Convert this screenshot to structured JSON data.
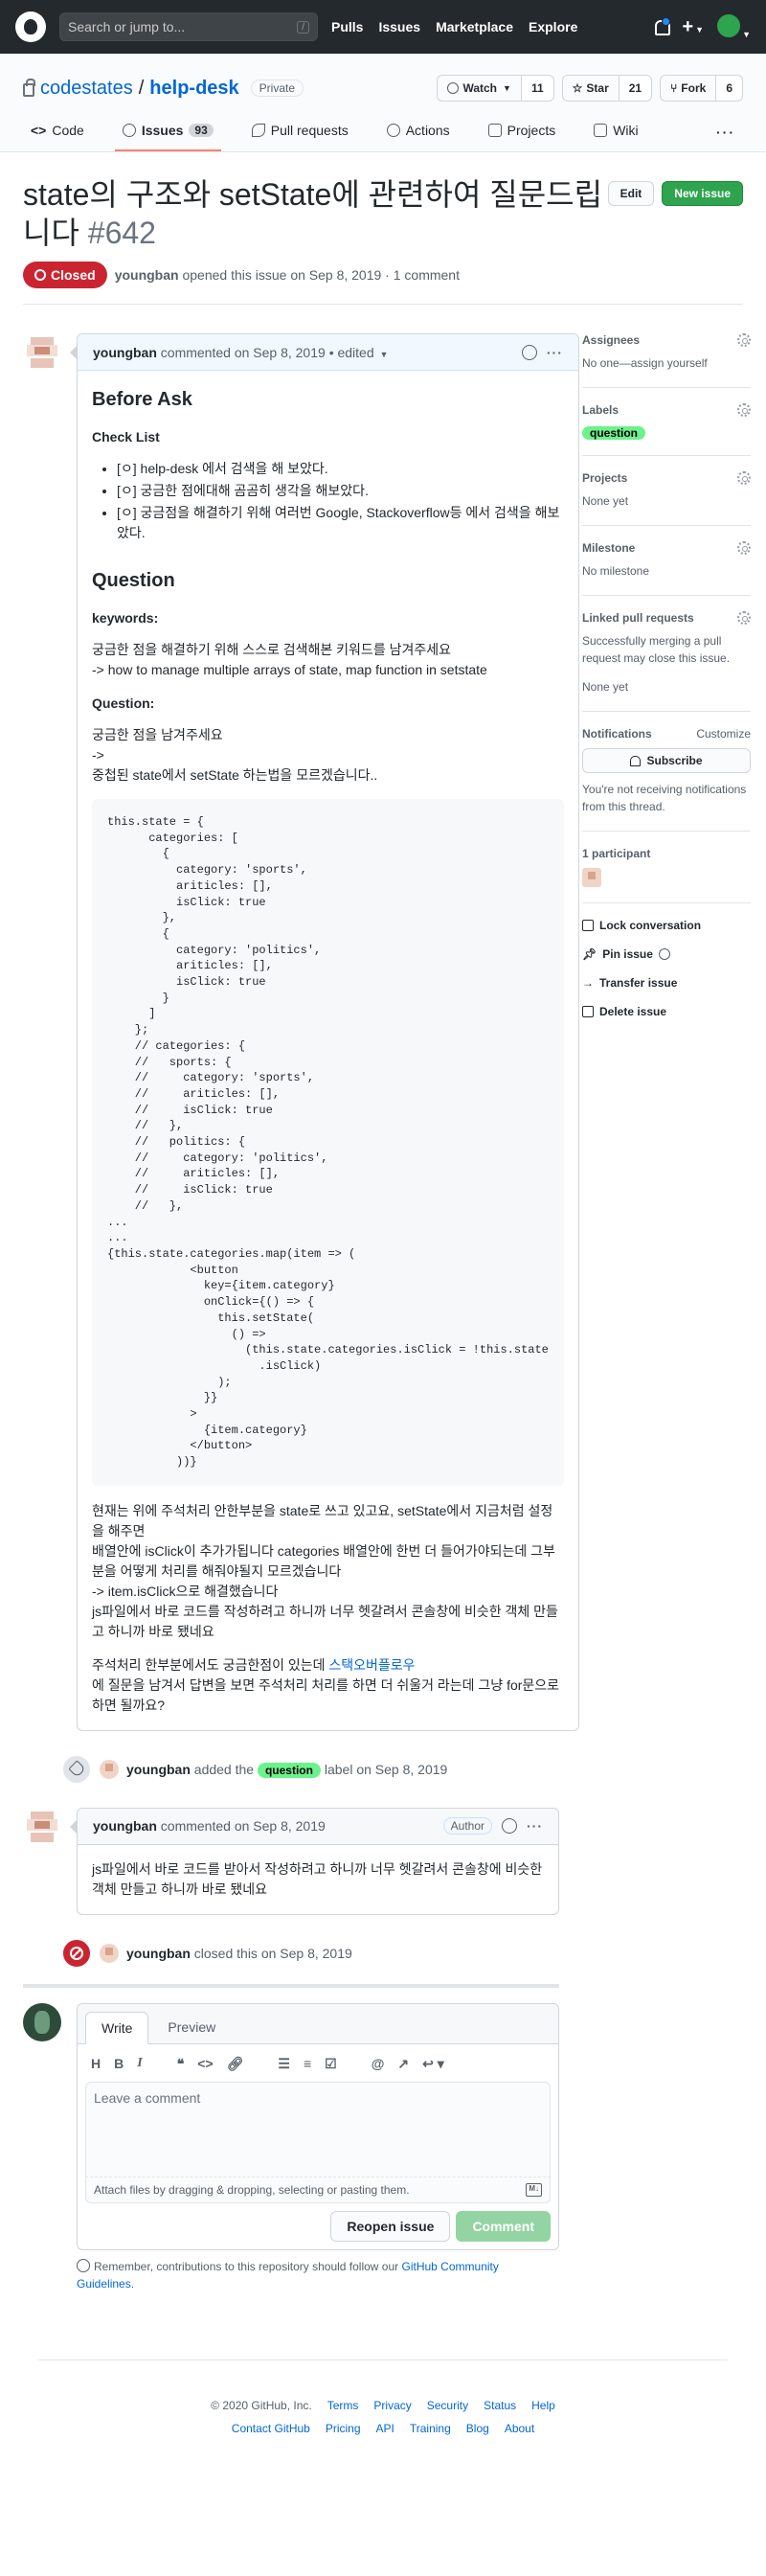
{
  "header": {
    "search_placeholder": "Search or jump to...",
    "slash": "/",
    "nav": [
      "Pulls",
      "Issues",
      "Marketplace",
      "Explore"
    ],
    "plus": "+"
  },
  "repo": {
    "owner": "codestates",
    "separator": "/",
    "name": "help-desk",
    "visibility": "Private",
    "watch_label": "Watch",
    "watch_count": "11",
    "star_label": "Star",
    "star_count": "21",
    "fork_label": "Fork",
    "fork_count": "6",
    "tabs": [
      {
        "label": "Code"
      },
      {
        "label": "Issues",
        "count": "93"
      },
      {
        "label": "Pull requests"
      },
      {
        "label": "Actions"
      },
      {
        "label": "Projects"
      },
      {
        "label": "Wiki"
      }
    ],
    "more": "···"
  },
  "issue": {
    "title": "state의 구조와 setState에 관련하여 질문드립니다",
    "number": "#642",
    "edit_label": "Edit",
    "new_issue_label": "New issue",
    "state": "Closed",
    "author": "youngban",
    "meta": "opened this issue on Sep 8, 2019 · 1 comment"
  },
  "first_comment": {
    "author": "youngban",
    "action": "commented on Sep 8, 2019",
    "edited": "• edited",
    "before_ask": "Before Ask",
    "check_list": "Check List",
    "checklist_items": [
      "[ㅇ] help-desk 에서 검색을 해 보았다.",
      "[ㅇ] 궁금한 점에대해 곰곰히 생각을 해보았다.",
      "[ㅇ] 궁금점을 해결하기 위해 여러번 Google, Stackoverflow등 에서 검색을 해보았다."
    ],
    "question_heading": "Question",
    "keywords_heading": "keywords:",
    "keywords_line1": "궁금한 점을 해결하기 위해 스스로 검색해본 키워드를 남겨주세요",
    "keywords_line2": "-> how to manage multiple arrays of state, map function in setstate",
    "question_sub": "Question:",
    "question_line1": "궁금한 점을 남겨주세요",
    "question_line2": "->",
    "question_line3": "중첩된 state에서 setState 하는법을 모르겠습니다..",
    "code": "this.state = {\n      categories: [\n        {\n          category: 'sports',\n          ariticles: [],\n          isClick: true\n        },\n        {\n          category: 'politics',\n          ariticles: [],\n          isClick: true\n        }\n      ]\n    };\n    // categories: {\n    //   sports: {\n    //     category: 'sports',\n    //     ariticles: [],\n    //     isClick: true\n    //   },\n    //   politics: {\n    //     category: 'politics',\n    //     ariticles: [],\n    //     isClick: true\n    //   },\n...\n...\n{this.state.categories.map(item => (\n            <button\n              key={item.category}\n              onClick={() => {\n                this.setState(\n                  () =>\n                    (this.state.categories.isClick = !this.state\n                      .isClick)\n                );\n              }}\n            >\n              {item.category}\n            </button>\n          ))}",
    "para1_l1": "현재는 위에 주석처리 안한부분을 state로 쓰고 있고요, setState에서 지금처럼 설정을 해주면",
    "para1_l2": "배열안에 isClick이 추가가됩니다 categories 배열안에 한번 더 들어가야되는데 그부분을 어떻게 처리를 해줘야될지 모르겠습니다",
    "para1_l3": "-> item.isClick으로 해결했습니다",
    "para1_l4": "js파일에서 바로 코드를 작성하려고 하니까 너무 헷갈려서 콘솔창에 비슷한 객체 만들고 하니까 바로 됐네요",
    "para2_pre": "주석처리 한부분에서도 궁금한점이 있는데 ",
    "para2_link": "스택오버플로우",
    "para2_post": "에 질문을 남겨서 답변을 보면 주석처리 처리를 하면 더 쉬울거 라는데 그냥 for문으로 하면 될까요?"
  },
  "label_event": {
    "author": "youngban",
    "added": "added the",
    "label": "question",
    "suffix": "label on Sep 8, 2019"
  },
  "second_comment": {
    "author": "youngban",
    "action": "commented on Sep 8, 2019",
    "badge": "Author",
    "body": "js파일에서 바로 코드를 받아서 작성하려고 하니까 너무 헷갈려서 콘솔창에 비슷한 객체 만들고 하니까 바로 됐네요"
  },
  "close_event": {
    "author": "youngban",
    "text": "closed this on Sep 8, 2019"
  },
  "new_comment": {
    "tab_write": "Write",
    "tab_preview": "Preview",
    "placeholder": "Leave a comment",
    "attach_hint": "Attach files by dragging & dropping, selecting or pasting them.",
    "md_icon": "M↓",
    "reopen_label": "Reopen issue",
    "comment_label": "Comment",
    "guidelines_pre": "Remember, contributions to this repository should follow our ",
    "guidelines_link": "GitHub Community Guidelines",
    "guidelines_post": "."
  },
  "sidebar": {
    "assignees_title": "Assignees",
    "assignees_value": "No one—assign yourself",
    "labels_title": "Labels",
    "labels_value": "question",
    "projects_title": "Projects",
    "projects_value": "None yet",
    "milestone_title": "Milestone",
    "milestone_value": "No milestone",
    "linked_title": "Linked pull requests",
    "linked_desc": "Successfully merging a pull request may close this issue.",
    "linked_value": "None yet",
    "notifications_title": "Notifications",
    "customize": "Customize",
    "subscribe_label": "Subscribe",
    "notifications_desc": "You're not receiving notifications from this thread.",
    "participants_title": "1 participant",
    "lock_label": "Lock conversation",
    "pin_label": "Pin issue",
    "transfer_label": "Transfer issue",
    "delete_label": "Delete issue"
  },
  "footer": {
    "copyright": "© 2020 GitHub, Inc.",
    "row1": [
      "Terms",
      "Privacy",
      "Security",
      "Status",
      "Help"
    ],
    "row2": [
      "Contact GitHub",
      "Pricing",
      "API",
      "Training",
      "Blog",
      "About"
    ]
  },
  "colors": {
    "closed": "#cb2431",
    "label_question": "#6cf28c",
    "accent_link": "#0366d6",
    "new_issue": "#2ea44f"
  }
}
